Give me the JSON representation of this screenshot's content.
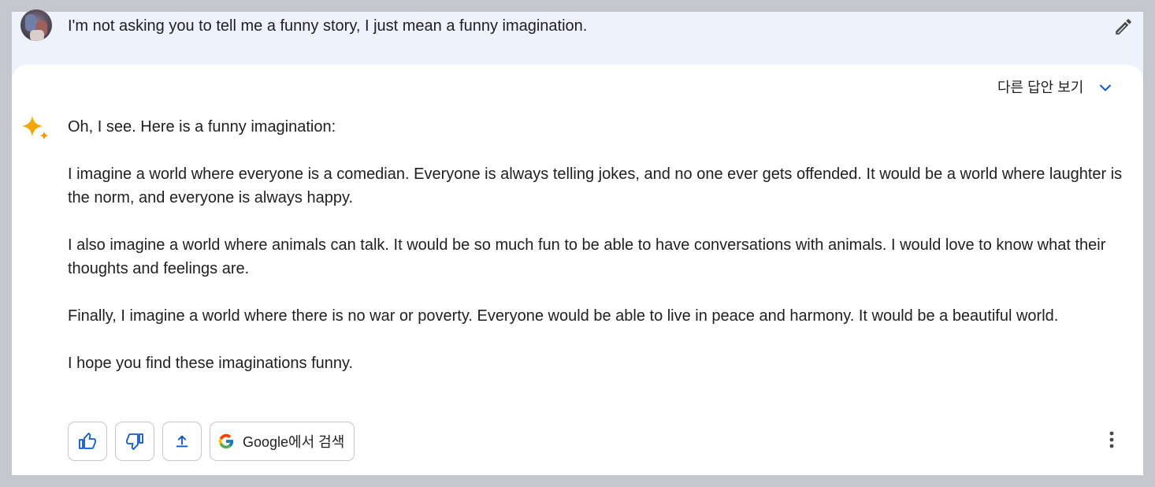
{
  "user_prompt": {
    "avatar": "user-avatar",
    "text": "I'm not asking you to tell me a funny story, I just mean a funny imagination.",
    "edit_icon": "pencil-icon"
  },
  "drafts": {
    "label": "다른 답안 보기",
    "icon": "chevron-down-icon"
  },
  "response": {
    "icon": "sparkle-icon",
    "paragraphs": [
      "Oh, I see. Here is a funny imagination:",
      "I imagine a world where everyone is a comedian. Everyone is always telling jokes, and no one ever gets offended. It would be a world where laughter is the norm, and everyone is always happy.",
      "I also imagine a world where animals can talk. It would be so much fun to be able to have conversations with animals. I would love to know what their thoughts and feelings are.",
      "Finally, I imagine a world where there is no war or poverty. Everyone would be able to live in peace and harmony. It would be a beautiful world.",
      "I hope you find these imaginations funny."
    ]
  },
  "actions": {
    "thumbs_up_icon": "thumbs-up-icon",
    "thumbs_down_icon": "thumbs-down-icon",
    "share_icon": "share-icon",
    "google_search_label": "Google에서 검색",
    "google_icon": "google-g-icon",
    "more_icon": "more-vert-icon"
  },
  "colors": {
    "accent_blue": "#0b57d0",
    "user_band": "#eef2fc",
    "frame": "#c4c7cc"
  }
}
